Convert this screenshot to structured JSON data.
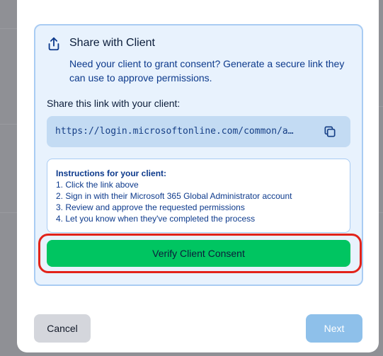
{
  "share": {
    "title": "Share with Client",
    "description": "Need your client to grant consent? Generate a secure link they can use to approve permissions.",
    "link_label": "Share this link with your client:",
    "link_url": "https://login.microsoftonline.com/common/a…",
    "icons": {
      "share": "share-icon",
      "copy": "copy-icon"
    }
  },
  "instructions": {
    "title": "Instructions for your client:",
    "steps": [
      "1. Click the link above",
      "2. Sign in with their Microsoft 365 Global Administrator account",
      "3. Review and approve the requested permissions",
      "4. Let you know when they've completed the process"
    ]
  },
  "buttons": {
    "verify": "Verify Client Consent",
    "cancel": "Cancel",
    "next": "Next"
  },
  "colors": {
    "card_bg": "#e8f2fd",
    "card_border": "#a9ccf3",
    "verify": "#00c561",
    "highlight": "#e2231a",
    "next_disabled": "#8ec0ea",
    "cancel": "#d4d6dc"
  }
}
